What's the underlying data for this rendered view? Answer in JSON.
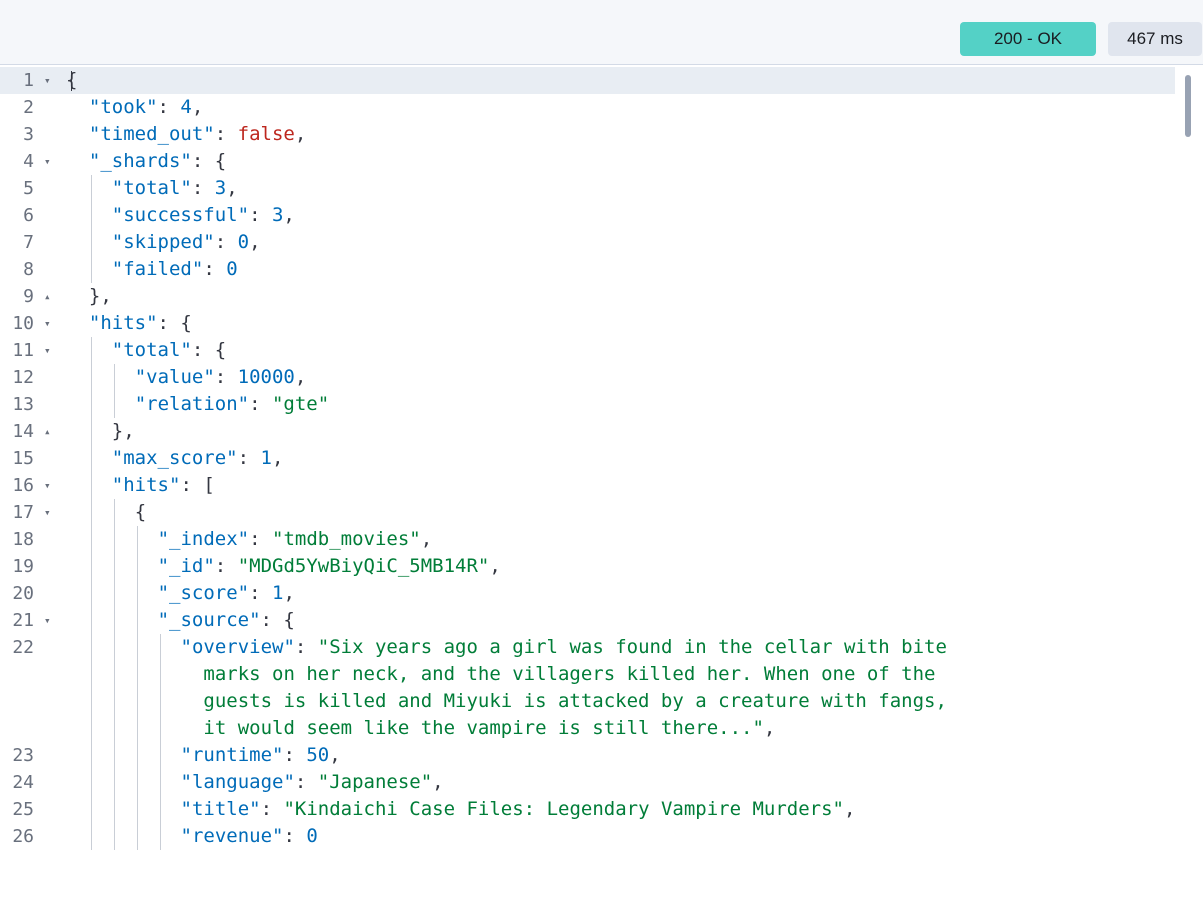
{
  "response": {
    "status": "200 - OK",
    "time": "467 ms"
  },
  "editor": {
    "lines": [
      {
        "n": "1",
        "fold": "open",
        "indent": 0,
        "tokens": [
          [
            "p",
            "{"
          ]
        ],
        "active": true
      },
      {
        "n": "2",
        "indent": 1,
        "tokens": [
          [
            "k",
            "\"took\""
          ],
          [
            "p",
            ": "
          ],
          [
            "n",
            "4"
          ],
          [
            "p",
            ","
          ]
        ]
      },
      {
        "n": "3",
        "indent": 1,
        "tokens": [
          [
            "k",
            "\"timed_out\""
          ],
          [
            "p",
            ": "
          ],
          [
            "b",
            "false"
          ],
          [
            "p",
            ","
          ]
        ]
      },
      {
        "n": "4",
        "fold": "open",
        "indent": 1,
        "tokens": [
          [
            "k",
            "\"_shards\""
          ],
          [
            "p",
            ": {"
          ]
        ]
      },
      {
        "n": "5",
        "indent": 2,
        "tokens": [
          [
            "k",
            "\"total\""
          ],
          [
            "p",
            ": "
          ],
          [
            "n",
            "3"
          ],
          [
            "p",
            ","
          ]
        ]
      },
      {
        "n": "6",
        "indent": 2,
        "tokens": [
          [
            "k",
            "\"successful\""
          ],
          [
            "p",
            ": "
          ],
          [
            "n",
            "3"
          ],
          [
            "p",
            ","
          ]
        ]
      },
      {
        "n": "7",
        "indent": 2,
        "tokens": [
          [
            "k",
            "\"skipped\""
          ],
          [
            "p",
            ": "
          ],
          [
            "n",
            "0"
          ],
          [
            "p",
            ","
          ]
        ]
      },
      {
        "n": "8",
        "indent": 2,
        "tokens": [
          [
            "k",
            "\"failed\""
          ],
          [
            "p",
            ": "
          ],
          [
            "n",
            "0"
          ]
        ]
      },
      {
        "n": "9",
        "fold": "close",
        "indent": 1,
        "tokens": [
          [
            "p",
            "},"
          ]
        ]
      },
      {
        "n": "10",
        "fold": "open",
        "indent": 1,
        "tokens": [
          [
            "k",
            "\"hits\""
          ],
          [
            "p",
            ": {"
          ]
        ]
      },
      {
        "n": "11",
        "fold": "open",
        "indent": 2,
        "tokens": [
          [
            "k",
            "\"total\""
          ],
          [
            "p",
            ": {"
          ]
        ]
      },
      {
        "n": "12",
        "indent": 3,
        "tokens": [
          [
            "k",
            "\"value\""
          ],
          [
            "p",
            ": "
          ],
          [
            "n",
            "10000"
          ],
          [
            "p",
            ","
          ]
        ]
      },
      {
        "n": "13",
        "indent": 3,
        "tokens": [
          [
            "k",
            "\"relation\""
          ],
          [
            "p",
            ": "
          ],
          [
            "s",
            "\"gte\""
          ]
        ]
      },
      {
        "n": "14",
        "fold": "close",
        "indent": 2,
        "tokens": [
          [
            "p",
            "},"
          ]
        ]
      },
      {
        "n": "15",
        "indent": 2,
        "tokens": [
          [
            "k",
            "\"max_score\""
          ],
          [
            "p",
            ": "
          ],
          [
            "n",
            "1"
          ],
          [
            "p",
            ","
          ]
        ]
      },
      {
        "n": "16",
        "fold": "open",
        "indent": 2,
        "tokens": [
          [
            "k",
            "\"hits\""
          ],
          [
            "p",
            ": ["
          ]
        ]
      },
      {
        "n": "17",
        "fold": "open",
        "indent": 3,
        "tokens": [
          [
            "p",
            "{"
          ]
        ]
      },
      {
        "n": "18",
        "indent": 4,
        "tokens": [
          [
            "k",
            "\"_index\""
          ],
          [
            "p",
            ": "
          ],
          [
            "s",
            "\"tmdb_movies\""
          ],
          [
            "p",
            ","
          ]
        ]
      },
      {
        "n": "19",
        "indent": 4,
        "tokens": [
          [
            "k",
            "\"_id\""
          ],
          [
            "p",
            ": "
          ],
          [
            "s",
            "\"MDGd5YwBiyQiC_5MB14R\""
          ],
          [
            "p",
            ","
          ]
        ]
      },
      {
        "n": "20",
        "indent": 4,
        "tokens": [
          [
            "k",
            "\"_score\""
          ],
          [
            "p",
            ": "
          ],
          [
            "n",
            "1"
          ],
          [
            "p",
            ","
          ]
        ]
      },
      {
        "n": "21",
        "fold": "open",
        "indent": 4,
        "tokens": [
          [
            "k",
            "\"_source\""
          ],
          [
            "p",
            ": {"
          ]
        ]
      },
      {
        "n": "22",
        "indent": 5,
        "tokens": [
          [
            "k",
            "\"overview\""
          ],
          [
            "p",
            ": "
          ],
          [
            "s",
            "\"Six years ago a girl was found in the cellar with bite"
          ]
        ]
      },
      {
        "n": "",
        "indent": 5,
        "wrap": true,
        "tokens": [
          [
            "s",
            "  marks on her neck, and the villagers killed her. When one of the"
          ]
        ]
      },
      {
        "n": "",
        "indent": 5,
        "wrap": true,
        "tokens": [
          [
            "s",
            "  guests is killed and Miyuki is attacked by a creature with fangs,"
          ]
        ]
      },
      {
        "n": "",
        "indent": 5,
        "wrap": true,
        "tokens": [
          [
            "s",
            "  it would seem like the vampire is still there...\""
          ],
          [
            "p",
            ","
          ]
        ]
      },
      {
        "n": "23",
        "indent": 5,
        "tokens": [
          [
            "k",
            "\"runtime\""
          ],
          [
            "p",
            ": "
          ],
          [
            "n",
            "50"
          ],
          [
            "p",
            ","
          ]
        ]
      },
      {
        "n": "24",
        "indent": 5,
        "tokens": [
          [
            "k",
            "\"language\""
          ],
          [
            "p",
            ": "
          ],
          [
            "s",
            "\"Japanese\""
          ],
          [
            "p",
            ","
          ]
        ]
      },
      {
        "n": "25",
        "indent": 5,
        "tokens": [
          [
            "k",
            "\"title\""
          ],
          [
            "p",
            ": "
          ],
          [
            "s",
            "\"Kindaichi Case Files: Legendary Vampire Murders\""
          ],
          [
            "p",
            ","
          ]
        ]
      },
      {
        "n": "26",
        "indent": 5,
        "tokens": [
          [
            "k",
            "\"revenue\""
          ],
          [
            "p",
            ": "
          ],
          [
            "n",
            "0"
          ]
        ]
      }
    ]
  }
}
